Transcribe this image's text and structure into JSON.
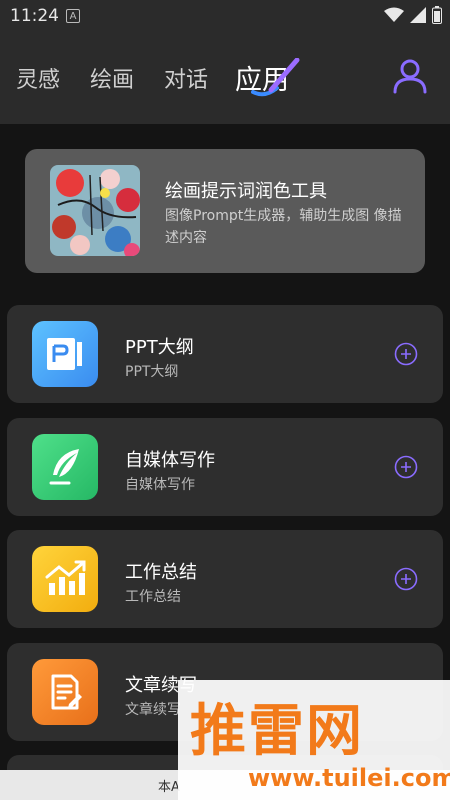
{
  "status_bar": {
    "time": "11:24",
    "notification_letter": "A"
  },
  "nav": {
    "tabs": [
      {
        "label": "灵感",
        "active": false
      },
      {
        "label": "绘画",
        "active": false
      },
      {
        "label": "对话",
        "active": false
      },
      {
        "label": "应用",
        "active": true
      }
    ],
    "accent_color": "#8a6cff"
  },
  "hero": {
    "title": "绘画提示词润色工具",
    "description": "图像Prompt生成器，辅助生成图 像描述内容"
  },
  "apps": [
    {
      "title": "PPT大纲",
      "subtitle": "PPT大纲",
      "icon": "ppt-icon",
      "color": "#4aa8ff"
    },
    {
      "title": "自媒体写作",
      "subtitle": "自媒体写作",
      "icon": "feather-icon",
      "color": "#3ecf7a"
    },
    {
      "title": "工作总结",
      "subtitle": "工作总结",
      "icon": "bar-chart-icon",
      "color": "#f6c21c"
    },
    {
      "title": "文章续写",
      "subtitle": "文章续写",
      "icon": "document-edit-icon",
      "color": "#f28a28"
    }
  ],
  "bottom": {
    "text": "本A"
  },
  "watermark": {
    "brand": "推雷网",
    "url": "www.tuilei.com"
  }
}
